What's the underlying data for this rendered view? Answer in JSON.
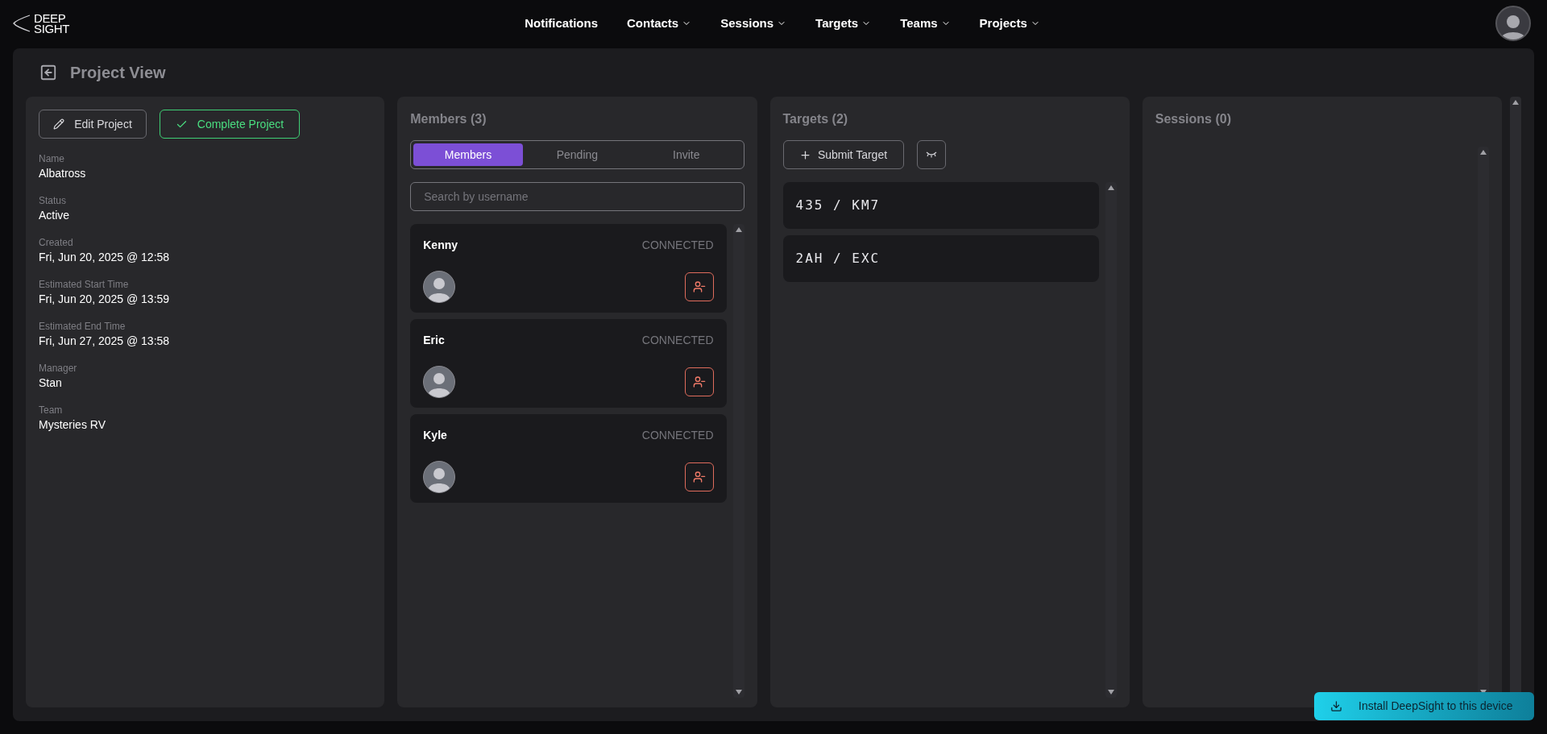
{
  "logo": {
    "lines": [
      "DEEP",
      "SIGHT"
    ]
  },
  "nav": [
    {
      "label": "Notifications",
      "dropdown": false
    },
    {
      "label": "Contacts",
      "dropdown": true
    },
    {
      "label": "Sessions",
      "dropdown": true
    },
    {
      "label": "Targets",
      "dropdown": true
    },
    {
      "label": "Teams",
      "dropdown": true
    },
    {
      "label": "Projects",
      "dropdown": true
    }
  ],
  "page_title": "Project View",
  "project": {
    "buttons": [
      {
        "label": "Edit Project",
        "kind": "edit"
      },
      {
        "label": "Complete Project",
        "kind": "complete"
      }
    ],
    "fields": [
      {
        "label": "Name",
        "value": "Albatross"
      },
      {
        "label": "Status",
        "value": "Active"
      },
      {
        "label": "Created",
        "value": "Fri, Jun 20, 2025 @ 12:58"
      },
      {
        "label": "Estimated Start Time",
        "value": "Fri, Jun 20, 2025 @ 13:59"
      },
      {
        "label": "Estimated End Time",
        "value": "Fri, Jun 27, 2025 @ 13:58"
      },
      {
        "label": "Manager",
        "value": "Stan"
      },
      {
        "label": "Team",
        "value": "Mysteries RV"
      }
    ]
  },
  "members": {
    "title": "Members (3)",
    "tabs": [
      {
        "label": "Members",
        "selected": true
      },
      {
        "label": "Pending",
        "selected": false
      },
      {
        "label": "Invite",
        "selected": false
      }
    ],
    "search": {
      "placeholder": "Search by username"
    },
    "items": [
      {
        "name": "Kenny",
        "status": "CONNECTED"
      },
      {
        "name": "Eric",
        "status": "CONNECTED"
      },
      {
        "name": "Kyle",
        "status": "CONNECTED"
      }
    ]
  },
  "targets": {
    "title": "Targets (2)",
    "submit_label": "Submit Target",
    "items": [
      "435 / KM7",
      "2AH / EXC"
    ]
  },
  "sessions": {
    "title": "Sessions (0)"
  },
  "install_button": "Install DeepSight to this device"
}
